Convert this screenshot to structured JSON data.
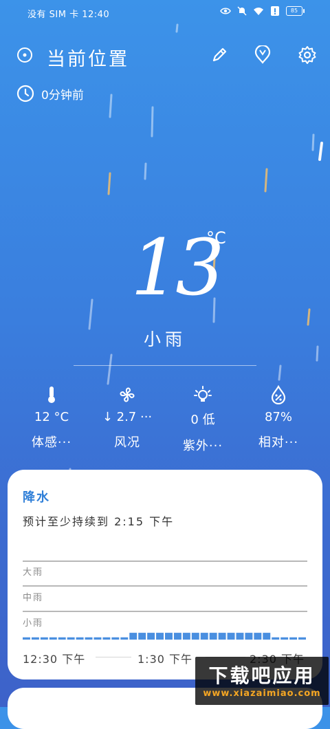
{
  "status_bar": {
    "carrier": "没有 SIM 卡 12:40",
    "battery": "85"
  },
  "header": {
    "location": "当前位置",
    "updated": "0分钟前"
  },
  "current": {
    "temperature": "13",
    "unit": "°C",
    "condition": "小雨"
  },
  "metrics": [
    {
      "icon": "thermometer-icon",
      "value": "12 °C",
      "label": "体感···"
    },
    {
      "icon": "fan-icon",
      "value": "↓ 2.7 ···",
      "label": "风况"
    },
    {
      "icon": "sun-bulb-icon",
      "value": "0 低",
      "label": "紫外···"
    },
    {
      "icon": "humidity-icon",
      "value": "87%",
      "label": "相对···"
    }
  ],
  "precipitation": {
    "title": "降水",
    "subtitle": "预计至少持续到 2:15 下午",
    "levels": [
      "大雨",
      "中雨",
      "小雨"
    ],
    "times": [
      "12:30 下午",
      "1:30 下午",
      "2:30 下午"
    ],
    "intensity": [
      0.15,
      0.15,
      0.15,
      0.15,
      0.15,
      0.15,
      0.15,
      0.15,
      0.15,
      0.15,
      0.15,
      0.15,
      0.45,
      0.45,
      0.45,
      0.45,
      0.45,
      0.45,
      0.45,
      0.45,
      0.45,
      0.45,
      0.45,
      0.45,
      0.45,
      0.45,
      0.45,
      0.45,
      0.15,
      0.15,
      0.15,
      0.15
    ],
    "bar_color": "#4a8fe0"
  },
  "watermark": {
    "main": "下载吧应用",
    "url": "www.xiazaimiao.com"
  }
}
